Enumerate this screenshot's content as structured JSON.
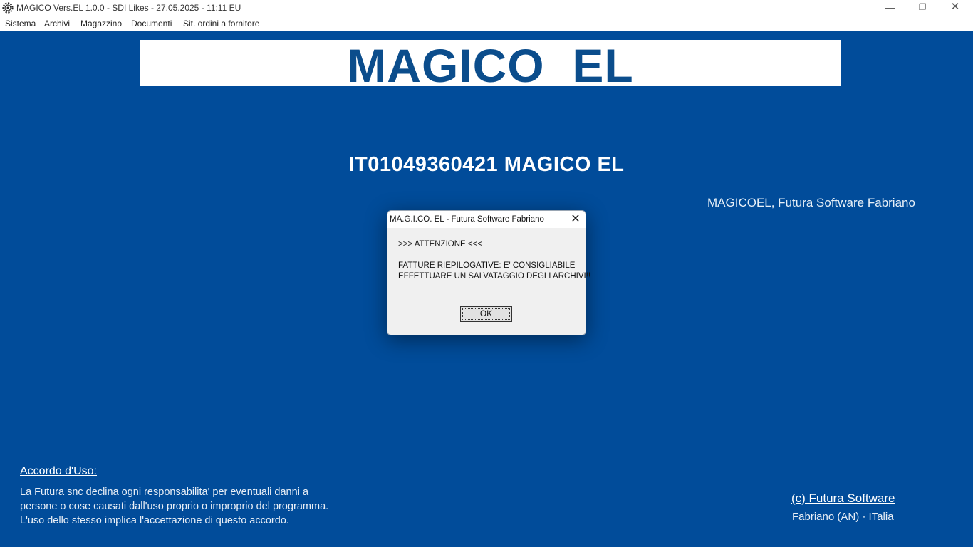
{
  "window": {
    "title": "MAGICO Vers.EL 1.0.0 - SDI Likes - 27.05.2025 - 11:11  EU",
    "minimize": "—",
    "maximize": "❐",
    "close": "✕"
  },
  "menu": [
    "Sistema",
    "Archivi",
    "Magazzino",
    "Documenti",
    "Sit. ordini a fornitore"
  ],
  "banner": {
    "title": "MAGICO  EL"
  },
  "company": {
    "line": "IT01049360421 MAGICO EL",
    "subline": "MAGICOEL, Futura Software Fabriano"
  },
  "dialog": {
    "title": "MA.G.I.CO. EL - Futura Software Fabriano",
    "close": "✕",
    "heading": ">>> ATTENZIONE <<<",
    "message_line1": "FATTURE RIEPILOGATIVE: E' CONSIGLIABILE",
    "message_line2": "EFFETTUARE UN SALVATAGGIO DEGLI ARCHIVI!!",
    "ok_label": "OK"
  },
  "footer": {
    "agreement_title": "Accordo d'Uso:",
    "agreement_lines": [
      "La Futura snc declina ogni responsabilita' per eventuali danni a",
      "persone o cose causati dall'uso proprio o improprio del programma.",
      "L'uso  dello stesso implica l'accettazione di questo accordo."
    ],
    "copyright": "(c) Futura Software",
    "location": "Fabriano (AN) - ITalia"
  },
  "colors": {
    "background": "#014c9a",
    "banner_text": "#0b4d8c"
  }
}
